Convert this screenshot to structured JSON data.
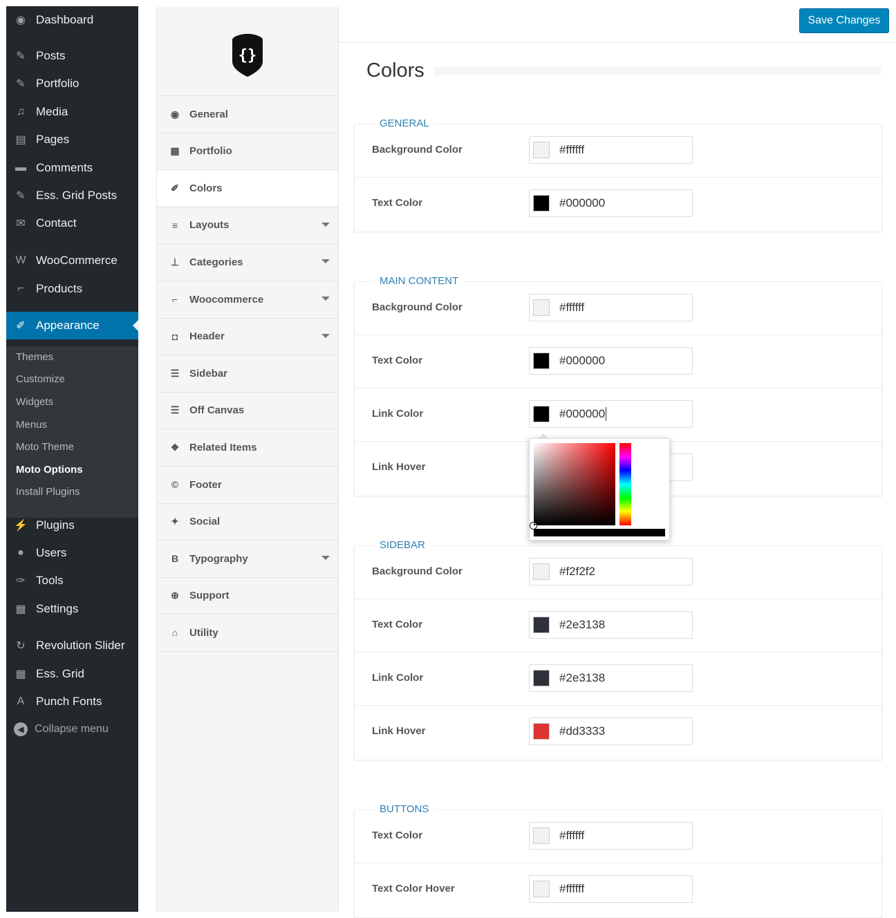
{
  "admin_menu": {
    "items": [
      {
        "label": "Dashboard",
        "icon": "dashboard-icon",
        "glyph": "◉"
      },
      {
        "label": "Posts",
        "icon": "pin-icon",
        "glyph": "✎"
      },
      {
        "label": "Portfolio",
        "icon": "pin-icon",
        "glyph": "✎"
      },
      {
        "label": "Media",
        "icon": "media-icon",
        "glyph": "♫"
      },
      {
        "label": "Pages",
        "icon": "pages-icon",
        "glyph": "▤"
      },
      {
        "label": "Comments",
        "icon": "comments-icon",
        "glyph": "▬"
      },
      {
        "label": "Ess. Grid Posts",
        "icon": "pin-icon",
        "glyph": "✎"
      },
      {
        "label": "Contact",
        "icon": "mail-icon",
        "glyph": "✉"
      },
      {
        "label": "WooCommerce",
        "icon": "woo-icon",
        "glyph": "W"
      },
      {
        "label": "Products",
        "icon": "cart-icon",
        "glyph": "⌐"
      },
      {
        "label": "Appearance",
        "icon": "brush-icon",
        "glyph": "✐"
      },
      {
        "label": "Plugins",
        "icon": "plug-icon",
        "glyph": "⚡"
      },
      {
        "label": "Users",
        "icon": "user-icon",
        "glyph": "●"
      },
      {
        "label": "Tools",
        "icon": "wrench-icon",
        "glyph": "✑"
      },
      {
        "label": "Settings",
        "icon": "settings-icon",
        "glyph": "▦"
      },
      {
        "label": "Revolution Slider",
        "icon": "refresh-icon",
        "glyph": "↻"
      },
      {
        "label": "Ess. Grid",
        "icon": "grid-icon",
        "glyph": "▦"
      },
      {
        "label": "Punch Fonts",
        "icon": "font-icon",
        "glyph": "A"
      }
    ],
    "submenu": [
      "Themes",
      "Customize",
      "Widgets",
      "Menus",
      "Moto Theme",
      "Moto Options",
      "Install Plugins"
    ],
    "collapse_label": "Collapse menu"
  },
  "theme_nav": {
    "items": [
      {
        "label": "General",
        "icon": "dashboard-icon",
        "glyph": "◉",
        "caret": false
      },
      {
        "label": "Portfolio",
        "icon": "grid-icon",
        "glyph": "▦",
        "caret": false
      },
      {
        "label": "Colors",
        "icon": "brush-icon",
        "glyph": "✐",
        "caret": false
      },
      {
        "label": "Layouts",
        "icon": "align-icon",
        "glyph": "≡",
        "caret": true
      },
      {
        "label": "Categories",
        "icon": "sitemap-icon",
        "glyph": "⊥",
        "caret": true
      },
      {
        "label": "Woocommerce",
        "icon": "cart-icon",
        "glyph": "⌐",
        "caret": true
      },
      {
        "label": "Header",
        "icon": "camera-icon",
        "glyph": "◘",
        "caret": true
      },
      {
        "label": "Sidebar",
        "icon": "list-icon",
        "glyph": "☰",
        "caret": false
      },
      {
        "label": "Off Canvas",
        "icon": "list-icon",
        "glyph": "☰",
        "caret": false
      },
      {
        "label": "Related Items",
        "icon": "cubes-icon",
        "glyph": "❖",
        "caret": false
      },
      {
        "label": "Footer",
        "icon": "copyright-icon",
        "glyph": "©",
        "caret": false
      },
      {
        "label": "Social",
        "icon": "twitter-icon",
        "glyph": "✦",
        "caret": false
      },
      {
        "label": "Typography",
        "icon": "bold-icon",
        "glyph": "B",
        "caret": true
      },
      {
        "label": "Support",
        "icon": "lifebuoy-icon",
        "glyph": "⊕",
        "caret": false
      },
      {
        "label": "Utility",
        "icon": "utility-icon",
        "glyph": "⌂",
        "caret": false
      }
    ]
  },
  "header": {
    "save_label": "Save Changes"
  },
  "page": {
    "title": "Colors"
  },
  "sections": [
    {
      "name": "general",
      "legend": "GENERAL",
      "rows": [
        {
          "label": "Background Color",
          "value": "#ffffff",
          "swatch": "#f2f2f2"
        },
        {
          "label": "Text Color",
          "value": "#000000",
          "swatch": "#000000"
        }
      ]
    },
    {
      "name": "main-content",
      "legend": "MAIN CONTENT",
      "rows": [
        {
          "label": "Background Color",
          "value": "#ffffff",
          "swatch": "#f2f2f2"
        },
        {
          "label": "Text Color",
          "value": "#000000",
          "swatch": "#000000"
        },
        {
          "label": "Link Color",
          "value": "#000000",
          "swatch": "#000000"
        },
        {
          "label": "Link Hover",
          "value": "",
          "swatch": ""
        }
      ]
    },
    {
      "name": "sidebar",
      "legend": "SIDEBAR",
      "rows": [
        {
          "label": "Background Color",
          "value": "#f2f2f2",
          "swatch": "#f2f2f2"
        },
        {
          "label": "Text Color",
          "value": "#2e3138",
          "swatch": "#2e3138"
        },
        {
          "label": "Link Color",
          "value": "#2e3138",
          "swatch": "#2e3138"
        },
        {
          "label": "Link Hover",
          "value": "#dd3333",
          "swatch": "#dd3333"
        }
      ]
    },
    {
      "name": "buttons",
      "legend": "BUTTONS",
      "rows": [
        {
          "label": "Text Color",
          "value": "#ffffff",
          "swatch": "#f2f2f2"
        },
        {
          "label": "Text Color Hover",
          "value": "#ffffff",
          "swatch": "#f2f2f2"
        }
      ]
    }
  ],
  "colors": {
    "accent": "#0073aa",
    "button": "#0085ba",
    "legend": "#2e7fb3",
    "menu_bg": "#23282d"
  }
}
